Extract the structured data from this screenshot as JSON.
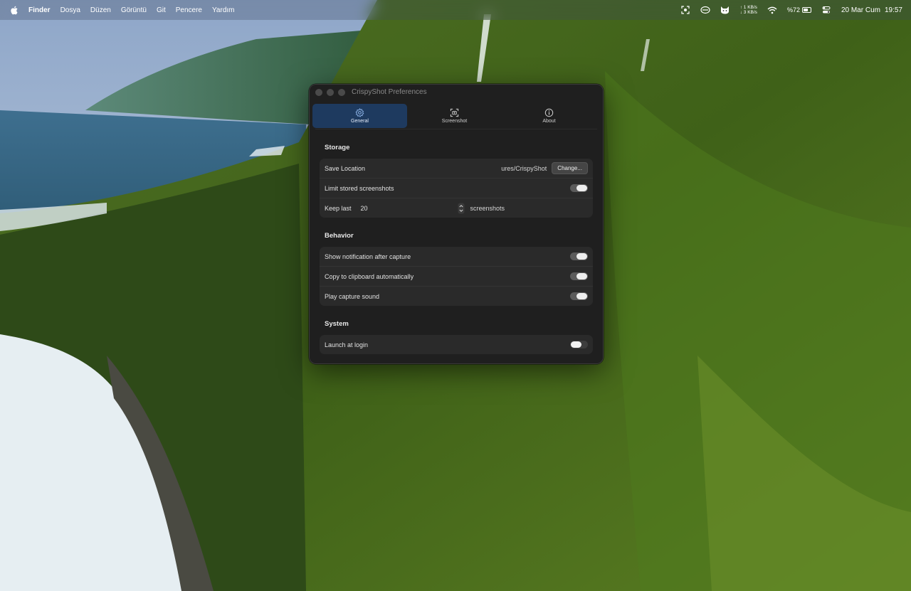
{
  "menubar": {
    "app": "Finder",
    "items": [
      "Dosya",
      "Düzen",
      "Görüntü",
      "Git",
      "Pencere",
      "Yardım"
    ],
    "net_up": "↑ 1 KB/s",
    "net_down": "↓ 3 KB/s",
    "battery": "%72",
    "battery_level": 0.72,
    "date": "20 Mar Cum",
    "time": "19:57"
  },
  "window": {
    "title": "CrispyShot Preferences",
    "tabs": [
      {
        "label": "General",
        "icon": "gear-icon",
        "active": true
      },
      {
        "label": "Screenshot",
        "icon": "screenshot-icon",
        "active": false
      },
      {
        "label": "About",
        "icon": "info-icon",
        "active": false
      }
    ],
    "storage": {
      "title": "Storage",
      "save_location_label": "Save Location",
      "save_location_value": "ures/CrispyShot",
      "change_button": "Change...",
      "limit_label": "Limit stored screenshots",
      "limit_on": true,
      "keep_last_label": "Keep last",
      "keep_last_value": "20",
      "keep_last_unit": "screenshots"
    },
    "behavior": {
      "title": "Behavior",
      "notification_label": "Show notification after capture",
      "notification_on": true,
      "clipboard_label": "Copy to clipboard automatically",
      "clipboard_on": true,
      "sound_label": "Play capture sound",
      "sound_on": true
    },
    "system": {
      "title": "System",
      "login_label": "Launch at login",
      "login_on": false
    }
  },
  "colors": {
    "active_tab": "#1e3a5f",
    "window_bg": "#1f1f1f",
    "group_bg": "#2a2a2a"
  }
}
